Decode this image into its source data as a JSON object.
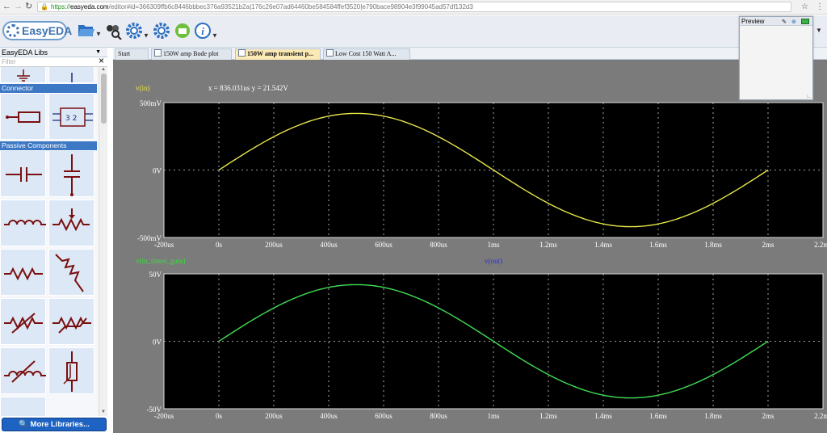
{
  "browser": {
    "url_scheme": "https://",
    "url_host": "easyeda.com",
    "url_path": "/editor#id=366309ffb6c8446bbbec376a93521b2a|176c26e07ad64460be584584ffef3520|e790bace98904e3f99045ad57df132d3",
    "back_icon": "back-arrow-icon",
    "forward_icon": "forward-arrow-icon",
    "reload_icon": "reload-icon",
    "lock_icon": "lock-icon",
    "star_icon": "star-icon",
    "menu_icon": "kebab-menu-icon"
  },
  "toolbar": {
    "logo_text": "EasyEDA",
    "icons": [
      "folder-open-icon",
      "find-component-icon",
      "settings-gear-icon",
      "gear-icon",
      "export-icon",
      "info-icon",
      "upload-icon"
    ]
  },
  "library": {
    "header": "EasyEDA Libs",
    "filter_placeholder": "Filter",
    "categories": [
      "Connector",
      "Passive Components"
    ],
    "more_button": "More Libraries..."
  },
  "tabs": [
    {
      "label": "Start",
      "active": false
    },
    {
      "label": "150W amp Bode plot",
      "active": false
    },
    {
      "label": "150W amp transient p...",
      "active": true
    },
    {
      "label": "Low Cost 150 Watt A...",
      "active": false
    }
  ],
  "preview": {
    "title": "Preview"
  },
  "chart_data": [
    {
      "type": "line",
      "title": "",
      "legend": [
        "v(in)"
      ],
      "cursor_readout": "x = 836.031us  y = 21.542V",
      "xlabel": "",
      "ylabel": "",
      "x_ticks": [
        "-200us",
        "0s",
        "200us",
        "400us",
        "600us",
        "800us",
        "1ms",
        "1.2ms",
        "1.4ms",
        "1.6ms",
        "1.8ms",
        "2ms",
        "2.2ms"
      ],
      "y_ticks": [
        "500mV",
        "0V",
        "-500mV"
      ],
      "xlim": [
        -0.0002,
        0.0022
      ],
      "ylim": [
        -0.5,
        0.5
      ],
      "grid": true,
      "series": [
        {
          "name": "v(in)",
          "color": "#e6e64a",
          "amplitude": 0.42,
          "frequency_hz": 500,
          "x_start": 0,
          "x_end": 0.002
        }
      ]
    },
    {
      "type": "line",
      "title": "",
      "legend": [
        "v(in_times_gain)",
        "v(out)"
      ],
      "xlabel": "",
      "ylabel": "",
      "x_ticks": [
        "-200us",
        "0s",
        "200us",
        "400us",
        "600us",
        "800us",
        "1ms",
        "1.2ms",
        "1.4ms",
        "1.6ms",
        "1.8ms",
        "2ms",
        "2.2ms"
      ],
      "y_ticks": [
        "50V",
        "0V",
        "-50V"
      ],
      "xlim": [
        -0.0002,
        0.0022
      ],
      "ylim": [
        -50,
        50
      ],
      "grid": true,
      "series": [
        {
          "name": "v(out)",
          "color": "#2d2dd8",
          "amplitude": 42,
          "frequency_hz": 500,
          "x_start": 0,
          "x_end": 0.002
        },
        {
          "name": "v(in_times_gain)",
          "color": "#3ddc3d",
          "amplitude": 42,
          "frequency_hz": 500,
          "x_start": 0,
          "x_end": 0.002
        }
      ]
    }
  ]
}
